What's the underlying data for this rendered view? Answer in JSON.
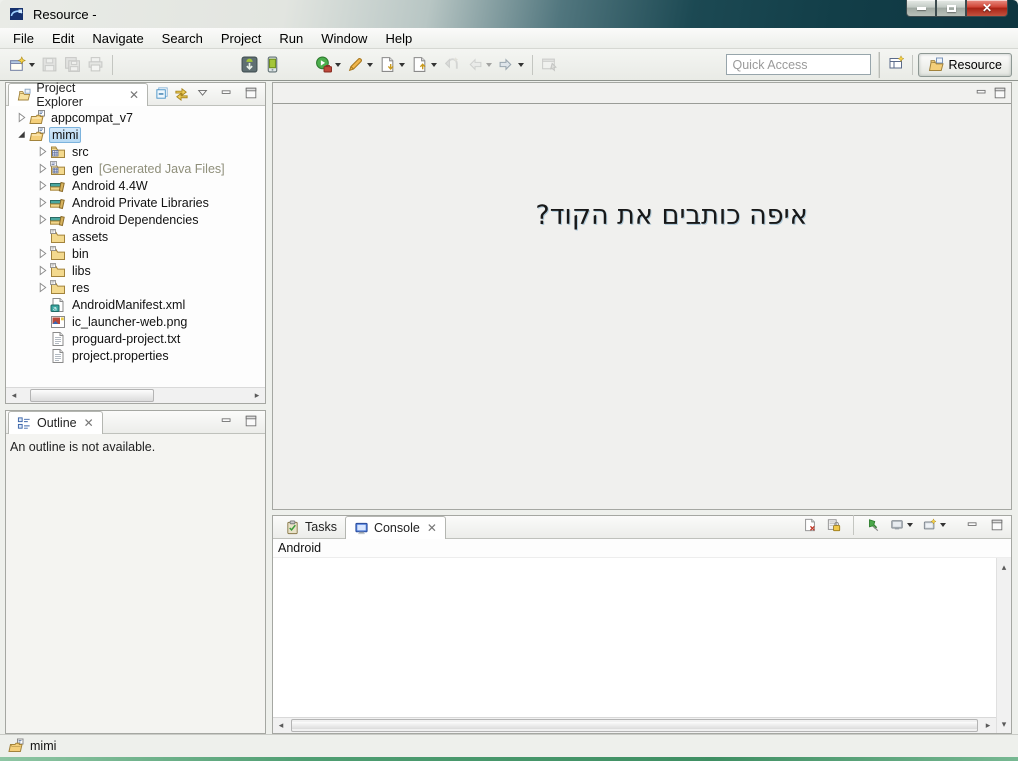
{
  "window": {
    "title": "Resource -",
    "controls": {
      "minimize": "minimize",
      "maximize": "maximize",
      "close": "close"
    }
  },
  "colors": {
    "selection_bg": "#b6d9f3",
    "selection_border": "#7cb3dd",
    "titlebar_teal": "#123e48",
    "folder_amber": "#f3d98e",
    "close_button_red": "#a82214"
  },
  "menubar": {
    "items": [
      "File",
      "Edit",
      "Navigate",
      "Search",
      "Project",
      "Run",
      "Window",
      "Help"
    ]
  },
  "toolbar": {
    "groups": [
      {
        "icons": [
          {
            "name": "new-wizard",
            "dropdown": true
          },
          {
            "name": "save",
            "disabled": true
          },
          {
            "name": "save-all",
            "disabled": true
          },
          {
            "name": "print",
            "disabled": true
          }
        ]
      },
      {
        "icons": [
          {
            "name": "android-sdk-manager"
          },
          {
            "name": "avd-manager"
          }
        ]
      },
      {
        "icons": [
          {
            "name": "run",
            "dropdown": true
          },
          {
            "name": "external-tools",
            "dropdown": true
          },
          {
            "name": "next-annotation",
            "dropdown": true
          },
          {
            "name": "previous-annotation",
            "dropdown": true
          },
          {
            "name": "last-edit-location",
            "disabled": true
          },
          {
            "name": "back",
            "disabled": true,
            "dropdown": true
          },
          {
            "name": "forward",
            "dropdown": true
          }
        ]
      },
      {
        "icons": [
          {
            "name": "pin-editor",
            "disabled": true
          }
        ]
      }
    ],
    "quick_access": {
      "placeholder": "Quick Access"
    },
    "perspectives": {
      "open_label": "open-perspective",
      "active": {
        "label": "Resource",
        "icon": "resource-perspective"
      }
    }
  },
  "project_explorer": {
    "tab": {
      "label": "Project Explorer",
      "icon": "project-explorer"
    },
    "tools": [
      {
        "name": "collapse-all"
      },
      {
        "name": "link-with-editor"
      }
    ],
    "menu_tools": [
      {
        "name": "view-menu"
      },
      {
        "name": "minimize-view"
      },
      {
        "name": "maximize-view"
      }
    ],
    "tree": [
      {
        "label": "appcompat_v7",
        "icon": "project-folder",
        "twistie": "collapsed",
        "level": 0
      },
      {
        "label": "mimi",
        "icon": "project-folder",
        "twistie": "expanded",
        "level": 0,
        "selected": true
      },
      {
        "label": "src",
        "icon": "src-folder",
        "twistie": "collapsed",
        "level": 1
      },
      {
        "label": "gen",
        "suffix": "[Generated Java Files]",
        "icon": "gen-folder",
        "twistie": "collapsed",
        "level": 1
      },
      {
        "label": "Android 4.4W",
        "icon": "library",
        "twistie": "collapsed",
        "level": 1
      },
      {
        "label": "Android Private Libraries",
        "icon": "library",
        "twistie": "collapsed",
        "level": 1
      },
      {
        "label": "Android Dependencies",
        "icon": "library",
        "twistie": "collapsed",
        "level": 1
      },
      {
        "label": "assets",
        "icon": "folder",
        "twistie": "none",
        "level": 1
      },
      {
        "label": "bin",
        "icon": "folder",
        "twistie": "collapsed",
        "level": 1
      },
      {
        "label": "libs",
        "icon": "folder",
        "twistie": "collapsed",
        "level": 1
      },
      {
        "label": "res",
        "icon": "folder",
        "twistie": "collapsed",
        "level": 1
      },
      {
        "label": "AndroidManifest.xml",
        "icon": "xml-file",
        "twistie": "none",
        "level": 1
      },
      {
        "label": "ic_launcher-web.png",
        "icon": "image-file",
        "twistie": "none",
        "level": 1
      },
      {
        "label": "proguard-project.txt",
        "icon": "text-file",
        "twistie": "none",
        "level": 1
      },
      {
        "label": "project.properties",
        "icon": "text-file",
        "twistie": "none",
        "level": 1
      }
    ]
  },
  "outline": {
    "tab": {
      "label": "Outline",
      "icon": "outline-view"
    },
    "menu_tools": [
      {
        "name": "minimize-view"
      },
      {
        "name": "maximize-view"
      }
    ],
    "message": "An outline is not available."
  },
  "editor": {
    "annotation": "איפה כותבים את הקוד?"
  },
  "console": {
    "tabs": [
      {
        "label": "Tasks",
        "icon": "tasks",
        "selected": false
      },
      {
        "label": "Console",
        "icon": "console-view",
        "selected": true,
        "closable": true
      }
    ],
    "tools": [
      {
        "name": "clear-console"
      },
      {
        "name": "scroll-lock"
      }
    ],
    "tools2": [
      {
        "name": "pin-console"
      },
      {
        "name": "display-selected-console",
        "dropdown": true
      },
      {
        "name": "open-console",
        "dropdown": true
      }
    ],
    "menu_tools": [
      {
        "name": "minimize-view"
      },
      {
        "name": "maximize-view"
      }
    ],
    "title": "Android"
  },
  "statusbar": {
    "icon": "project-folder",
    "label": "mimi"
  }
}
